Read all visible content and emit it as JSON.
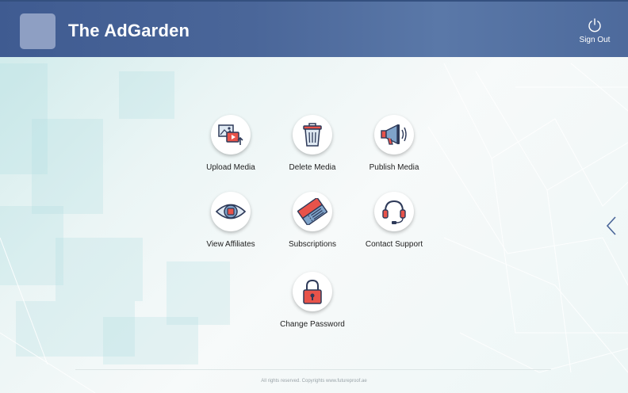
{
  "header": {
    "title": "The AdGarden",
    "signout_label": "Sign Out",
    "background_color": "#4a6699"
  },
  "menu": {
    "items": [
      {
        "label": "Upload Media",
        "icon": "upload-media-icon"
      },
      {
        "label": "Delete Media",
        "icon": "trash-icon"
      },
      {
        "label": "Publish Media",
        "icon": "megaphone-icon"
      },
      {
        "label": "View Affiliates",
        "icon": "eye-icon"
      },
      {
        "label": "Subscriptions",
        "icon": "tickets-icon"
      },
      {
        "label": "Contact Support",
        "icon": "headset-icon"
      },
      {
        "label": "Change Password",
        "icon": "padlock-icon"
      }
    ]
  },
  "footer": {
    "text": "All rights reserved. Copyrights www.futureproof.ae"
  },
  "colors": {
    "accent": "#e8534a",
    "icon_outline": "#2e3a59",
    "icon_fill_blue": "#7fa3c9"
  }
}
